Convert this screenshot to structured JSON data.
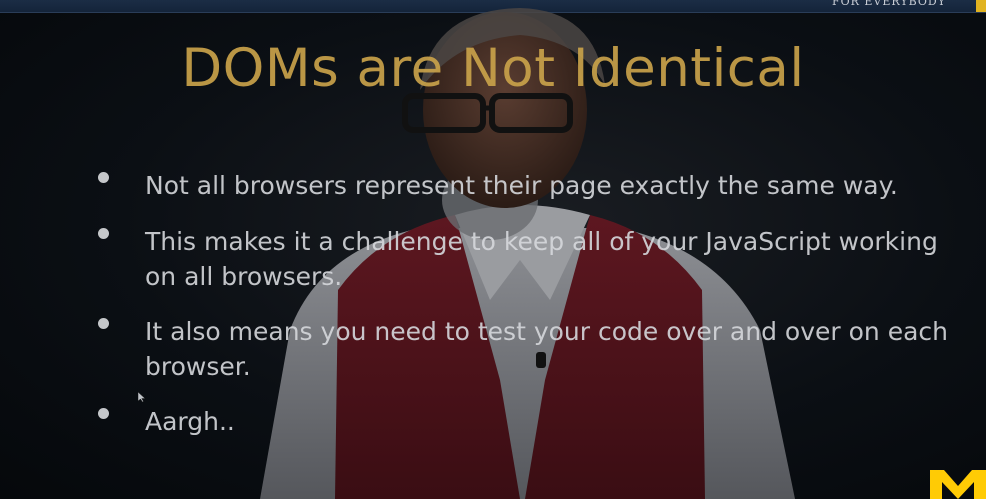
{
  "header": {
    "left_text": "",
    "right_text": "FOR EVERYBODY"
  },
  "slide": {
    "title": "DOMs are Not Identical",
    "bullets": [
      "Not all browsers represent their page exactly the same way.",
      "This makes it a challenge to keep all of your JavaScript working on all browsers.",
      "It also means you need to test your code over and over on each browser.",
      "Aargh.."
    ]
  },
  "colors": {
    "title": "#c9a24a",
    "text": "#d6d8dc",
    "header_bar": "#1b2d45",
    "accent": "#e1b320",
    "logo": "#ffcb05",
    "vest": "#6b1a22"
  },
  "icons": {
    "bullet": "filled-circle",
    "logo": "block-m-logo",
    "cursor": "arrow-cursor"
  }
}
